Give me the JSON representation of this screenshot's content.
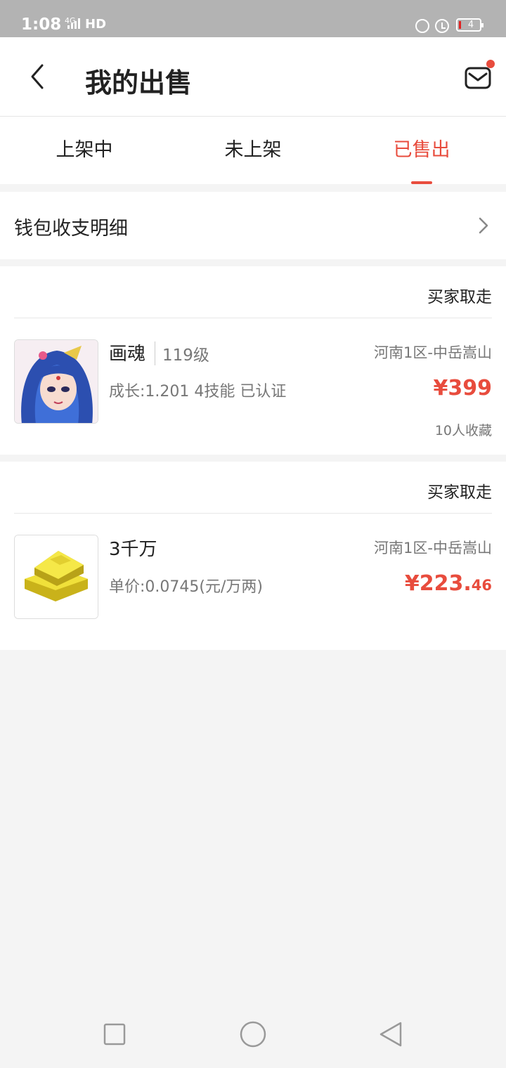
{
  "status_bar": {
    "time": "1:08",
    "network": "4G",
    "hd": "HD",
    "battery": "4"
  },
  "header": {
    "title": "我的出售"
  },
  "tabs": [
    {
      "label": "上架中",
      "active": false
    },
    {
      "label": "未上架",
      "active": false
    },
    {
      "label": "已售出",
      "active": true
    }
  ],
  "wallet": {
    "label": "钱包收支明细"
  },
  "orders": [
    {
      "status": "买家取走",
      "name": "画魂",
      "level": "119级",
      "desc": "成长:1.201 4技能 已认证",
      "server": "河南1区-中岳嵩山",
      "price_main": "¥399",
      "price_cents": "",
      "favorites": "10人收藏",
      "thumb_icon": "character-portrait"
    },
    {
      "status": "买家取走",
      "name": "3千万",
      "level": "",
      "desc": "单价:0.0745(元/万两)",
      "server": "河南1区-中岳嵩山",
      "price_main": "¥223.",
      "price_cents": "46",
      "favorites": "",
      "thumb_icon": "gold-bars"
    }
  ],
  "colors": {
    "accent": "#e84c3d",
    "status_bar": "#b3b3b3",
    "background": "#f4f4f4"
  }
}
